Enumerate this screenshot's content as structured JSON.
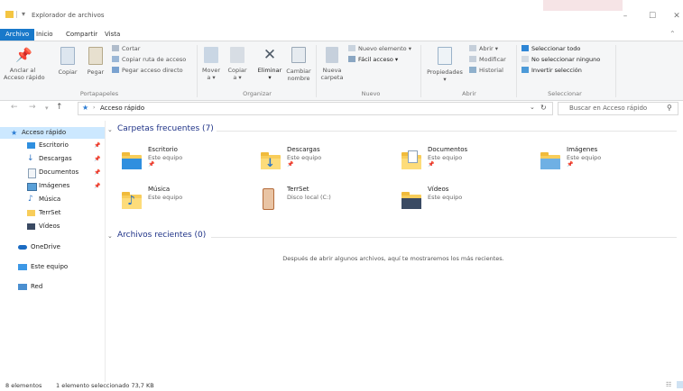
{
  "window": {
    "title": "Explorador de archivos",
    "controls": {
      "minimize": "–",
      "maximize": "☐",
      "close": "✕"
    }
  },
  "ribbon_tabs": [
    "Archivo",
    "Inicio",
    "Compartir",
    "Vista"
  ],
  "ribbon": {
    "portapapeles": {
      "pin_label": "Anclar al\nAcceso rápido",
      "copy_label": "Copiar",
      "paste_label": "Pegar",
      "cut": "Cortar",
      "copy_path": "Copiar ruta de acceso",
      "paste_shortcut": "Pegar acceso directo",
      "group_label": "Portapapeles"
    },
    "organizar": {
      "move_label": "Mover\na ▾",
      "copy_label": "Copiar\na ▾",
      "delete_label": "Eliminar\n▾",
      "rename_label": "Cambiar\nnombre",
      "group_label": "Organizar"
    },
    "nuevo": {
      "new_folder_label": "Nueva\ncarpeta",
      "new_item": "Nuevo elemento ▾",
      "easy_access": "Fácil acceso ▾",
      "group_label": "Nuevo"
    },
    "abrir": {
      "properties_label": "Propiedades\n▾",
      "open": "Abrir ▾",
      "modify": "Modificar",
      "history": "Historial",
      "group_label": "Abrir"
    },
    "seleccionar": {
      "select_all": "Seleccionar todo",
      "select_none": "No seleccionar ninguno",
      "invert": "Invertir selección",
      "group_label": "Seleccionar"
    }
  },
  "address": {
    "path": "Acceso rápido",
    "search_placeholder": "Buscar en Acceso rápido"
  },
  "sidebar": {
    "quick_access": "Acceso rápido",
    "items": [
      "Escritorio",
      "Descargas",
      "Documentos",
      "Imágenes",
      "Música",
      "TerrSet",
      "Vídeos"
    ],
    "onedrive": "OneDrive",
    "this_pc": "Este equipo",
    "network": "Red"
  },
  "frequent": {
    "header": "Carpetas frecuentes (7)",
    "items": [
      {
        "name": "Escritorio",
        "sub": "Este equipo"
      },
      {
        "name": "Descargas",
        "sub": "Este equipo"
      },
      {
        "name": "Documentos",
        "sub": "Este equipo"
      },
      {
        "name": "Imágenes",
        "sub": "Este equipo"
      },
      {
        "name": "Música",
        "sub": "Este equipo"
      },
      {
        "name": "TerrSet",
        "sub": "Disco local (C:)"
      },
      {
        "name": "Vídeos",
        "sub": "Este equipo"
      }
    ]
  },
  "recent": {
    "header": "Archivos recientes (0)",
    "empty_message": "Después de abrir algunos archivos, aquí te mostraremos los más recientes."
  },
  "status": {
    "count": "8 elementos",
    "selection": "1 elemento seleccionado  73,7 KB"
  },
  "colors": {
    "accent": "#1979ca",
    "selected": "#cce8ff",
    "folder": "#f8cd5a",
    "heading": "#1e3287"
  }
}
